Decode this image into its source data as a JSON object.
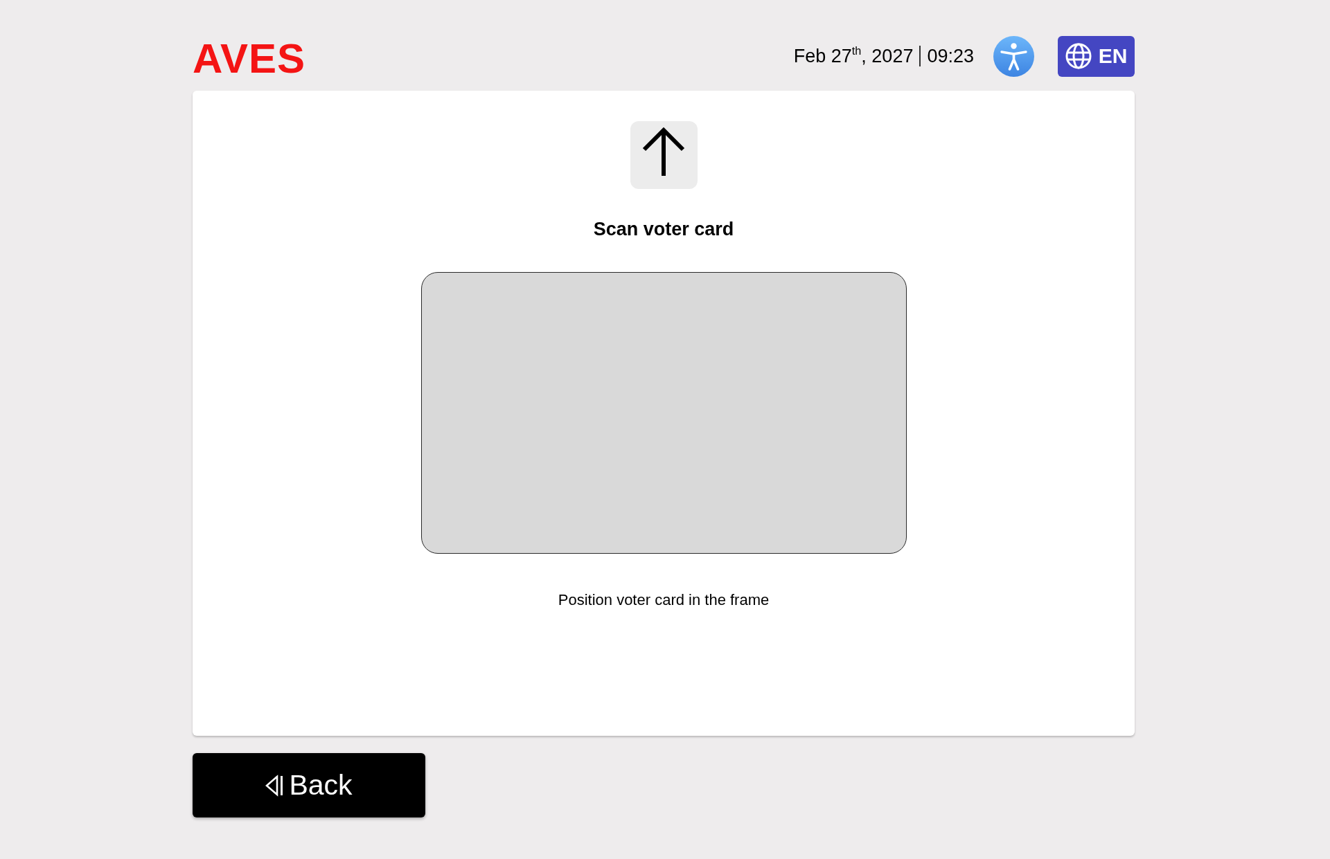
{
  "header": {
    "logo": "AVES",
    "date": "Feb 27$^{th}$, 2027",
    "time": "09:23",
    "language_button": {
      "label": "EN"
    }
  },
  "scan": {
    "title": "Scan voter card",
    "instruction": "Position voter card in the frame"
  },
  "back_button": {
    "label": "Back"
  }
}
